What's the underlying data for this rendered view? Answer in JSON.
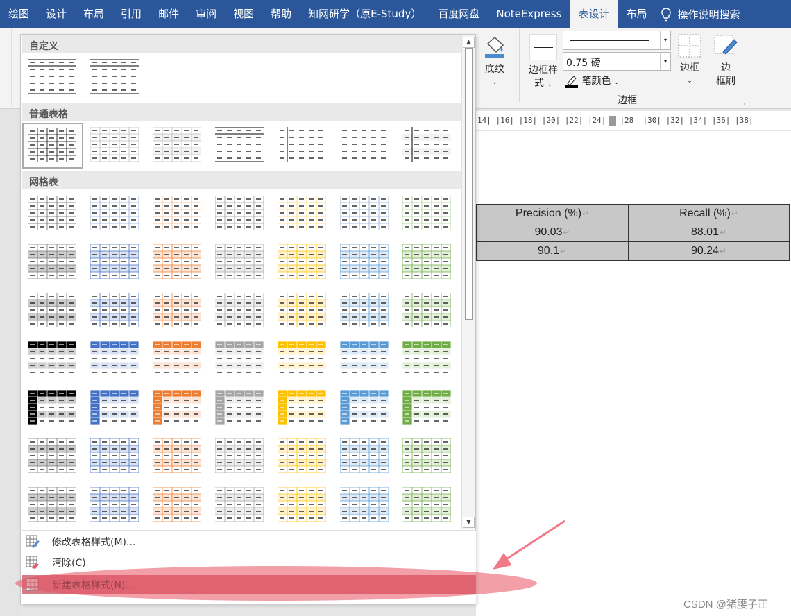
{
  "tabs": [
    "绘图",
    "设计",
    "布局",
    "引用",
    "邮件",
    "审阅",
    "视图",
    "帮助",
    "知网研学（原E-Study）",
    "百度网盘",
    "NoteExpress",
    "表设计",
    "布局"
  ],
  "active_tab": "表设计",
  "help_search": "操作说明搜索",
  "ribbon": {
    "shading": "底纹",
    "border_style_l1": "边框样",
    "border_style_l2": "式",
    "line_weight": "0.75 磅",
    "pen_color": "笔颜色",
    "borders": "边框",
    "border_painter_l1": "边",
    "border_painter_l2": "框刷",
    "group_label": "边框"
  },
  "gallery": {
    "sections": [
      "自定义",
      "普通表格",
      "网格表"
    ],
    "scroll_up": "▲",
    "scroll_down": "▼"
  },
  "menu": {
    "modify": "修改表格样式(M)...",
    "clear": "清除(C)",
    "new": "新建表格样式(N)..."
  },
  "document": {
    "ruler": "14| |16| |18| |20| |22| |24|",
    "ruler2": "|28| |30| |32| |34| |36| |38|",
    "table": {
      "headers": [
        "Precision (%)",
        "Recall (%)"
      ],
      "rows": [
        [
          "90.03",
          "88.01"
        ],
        [
          "90.1",
          "90.24"
        ]
      ]
    }
  },
  "watermark": "CSDN @猪腰子正",
  "colors": {
    "accent": "#2b579a",
    "blue": "#4472c4",
    "orange": "#ed7d31",
    "gray": "#a5a5a5",
    "gold": "#ffc000",
    "lightblue": "#5b9bd5",
    "green": "#70ad47"
  }
}
